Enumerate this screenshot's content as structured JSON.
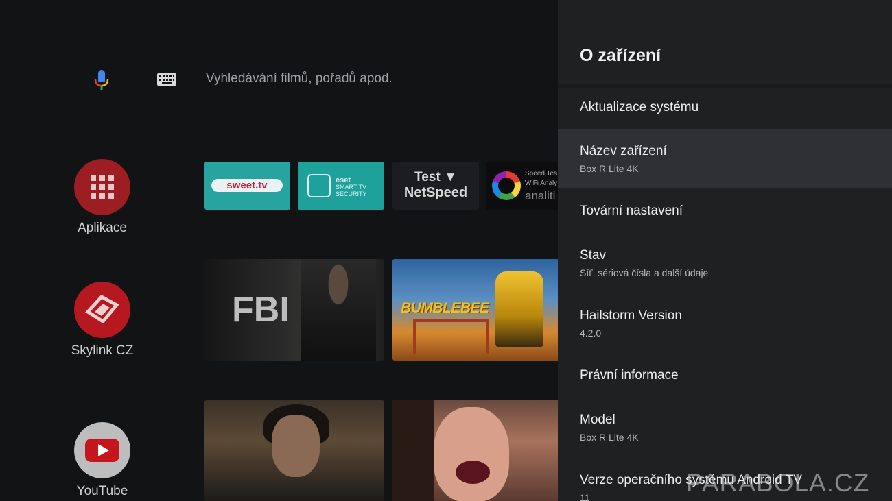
{
  "search": {
    "placeholder": "Vyhledávání filmů, pořadů apod."
  },
  "rail": {
    "items": [
      {
        "label": "Aplikace",
        "color": "#9c1d22"
      },
      {
        "label": "Skylink CZ",
        "color": "#b5191f"
      },
      {
        "label": "YouTube",
        "color": "#bdbdbd"
      }
    ]
  },
  "apps": {
    "sweet": {
      "label": "sweet.tv"
    },
    "eset": {
      "line1": "eset",
      "line2": "SMART TV",
      "line3": "SECURITY"
    },
    "netspeed": {
      "line1": "Test",
      "line2": "NetSpeed"
    },
    "speedtest": {
      "line1": "Speed Tes",
      "line2": "WiFi Analy",
      "line3": "analiti"
    }
  },
  "cards": {
    "fbi": {
      "title": "FBI"
    },
    "bumblebee": {
      "title": "BUMBLEBEE"
    }
  },
  "settings": {
    "title": "O zařízení",
    "items": [
      {
        "title": "Aktualizace systému"
      },
      {
        "title": "Název zařízení",
        "subtitle": "Box R Lite 4K"
      },
      {
        "title": "Tovární nastavení"
      },
      {
        "title": "Stav",
        "subtitle": "Síť, sériová čísla a další údaje"
      },
      {
        "title": "Hailstorm Version",
        "subtitle": "4.2.0"
      },
      {
        "title": "Právní informace"
      },
      {
        "title": "Model",
        "subtitle": "Box R Lite 4K"
      },
      {
        "title": "Verze operačního systému Android TV",
        "subtitle": "11"
      }
    ]
  },
  "watermark": "PARABOLA.CZ",
  "colors": {
    "panel_bg": "#1f2022",
    "focus_bg": "#2f3033",
    "home_bg": "#121315"
  }
}
